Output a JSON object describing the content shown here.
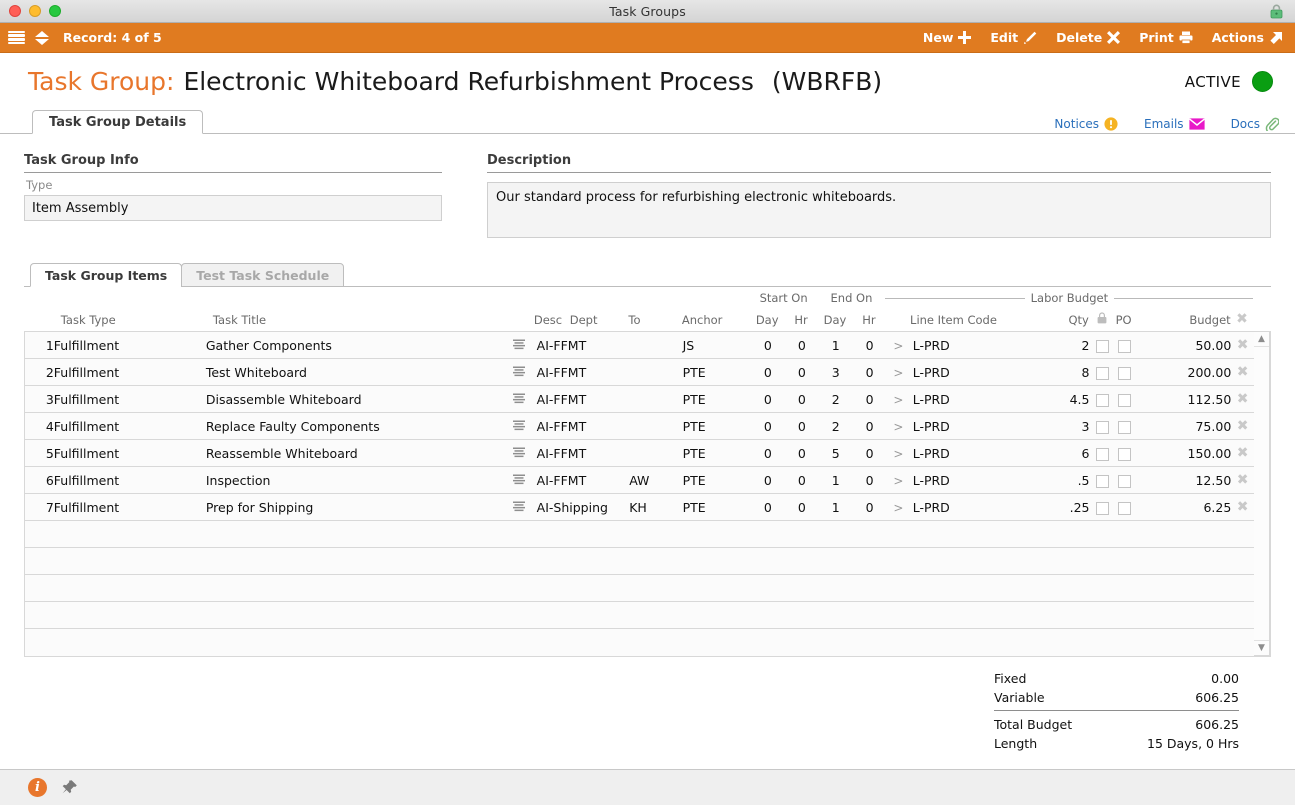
{
  "window": {
    "title": "Task Groups",
    "lock_icon": "lock-icon",
    "controls": [
      "close",
      "minimize",
      "zoom"
    ]
  },
  "toolbar": {
    "menu_icon": "hamburger-icon",
    "nav_icon": "up-down-arrows-icon",
    "record_label": "Record: 4 of 5",
    "accent_color": "#e07b20",
    "buttons": [
      {
        "label": "New",
        "icon": "plus-icon"
      },
      {
        "label": "Edit",
        "icon": "pencil-icon"
      },
      {
        "label": "Delete",
        "icon": "x-icon"
      },
      {
        "label": "Print",
        "icon": "printer-icon"
      },
      {
        "label": "Actions",
        "icon": "arrow-out-icon"
      }
    ]
  },
  "header": {
    "prefix": "Task Group:",
    "name": "Electronic Whiteboard Refurbishment Process",
    "code": "(WBRFB)",
    "status_text": "ACTIVE",
    "status_color": "#0a9e12",
    "prefix_color": "#e8762c"
  },
  "tabs_top": {
    "items": [
      {
        "label": "Task Group Details",
        "active": true
      }
    ],
    "links": [
      {
        "label": "Notices",
        "icon": "warning-icon"
      },
      {
        "label": "Emails",
        "icon": "envelope-icon"
      },
      {
        "label": "Docs",
        "icon": "paperclip-icon"
      }
    ]
  },
  "info_section": {
    "title": "Task Group Info",
    "type_label": "Type",
    "type_value": "Item Assembly"
  },
  "description_section": {
    "title": "Description",
    "value": "Our standard process for refurbishing electronic whiteboards."
  },
  "tabs_lower": [
    {
      "label": "Task Group Items",
      "active": true
    },
    {
      "label": "Test Task Schedule",
      "active": false
    }
  ],
  "grid": {
    "group_headers": [
      {
        "label": "Start On"
      },
      {
        "label": "End On"
      },
      {
        "label": "Labor Budget"
      }
    ],
    "columns": [
      "Task Type",
      "Task Title",
      "Desc",
      "Dept",
      "To",
      "Anchor",
      "Day",
      "Hr",
      "Day",
      "Hr",
      "Line Item Code",
      "Qty",
      "PO",
      "Budget"
    ],
    "lock_column_icon": "lock-icon",
    "delete_column_icon": "x-icon",
    "rows": [
      {
        "n": "1",
        "task_type": "Fulfillment",
        "task_title": "Gather Components",
        "desc": "desc-icon",
        "dept": "AI-FFMT",
        "to": "",
        "anchor": "JS",
        "start_day": "0",
        "start_hr": "0",
        "end_day": "1",
        "end_hr": "0",
        "line_item_code": "L-PRD",
        "qty": "2",
        "po": false,
        "budget": "50.00"
      },
      {
        "n": "2",
        "task_type": "Fulfillment",
        "task_title": "Test Whiteboard",
        "desc": "desc-icon",
        "dept": "AI-FFMT",
        "to": "",
        "anchor": "PTE",
        "start_day": "0",
        "start_hr": "0",
        "end_day": "3",
        "end_hr": "0",
        "line_item_code": "L-PRD",
        "qty": "8",
        "po": false,
        "budget": "200.00"
      },
      {
        "n": "3",
        "task_type": "Fulfillment",
        "task_title": "Disassemble Whiteboard",
        "desc": "desc-icon",
        "dept": "AI-FFMT",
        "to": "",
        "anchor": "PTE",
        "start_day": "0",
        "start_hr": "0",
        "end_day": "2",
        "end_hr": "0",
        "line_item_code": "L-PRD",
        "qty": "4.5",
        "po": false,
        "budget": "112.50"
      },
      {
        "n": "4",
        "task_type": "Fulfillment",
        "task_title": "Replace Faulty Components",
        "desc": "desc-icon",
        "dept": "AI-FFMT",
        "to": "",
        "anchor": "PTE",
        "start_day": "0",
        "start_hr": "0",
        "end_day": "2",
        "end_hr": "0",
        "line_item_code": "L-PRD",
        "qty": "3",
        "po": false,
        "budget": "75.00"
      },
      {
        "n": "5",
        "task_type": "Fulfillment",
        "task_title": "Reassemble Whiteboard",
        "desc": "desc-icon",
        "dept": "AI-FFMT",
        "to": "",
        "anchor": "PTE",
        "start_day": "0",
        "start_hr": "0",
        "end_day": "5",
        "end_hr": "0",
        "line_item_code": "L-PRD",
        "qty": "6",
        "po": false,
        "budget": "150.00"
      },
      {
        "n": "6",
        "task_type": "Fulfillment",
        "task_title": "Inspection",
        "desc": "desc-icon",
        "dept": "AI-FFMT",
        "to": "AW",
        "anchor": "PTE",
        "start_day": "0",
        "start_hr": "0",
        "end_day": "1",
        "end_hr": "0",
        "line_item_code": "L-PRD",
        "qty": ".5",
        "po": false,
        "budget": "12.50"
      },
      {
        "n": "7",
        "task_type": "Fulfillment",
        "task_title": "Prep for Shipping",
        "desc": "desc-icon",
        "dept": "AI-Shipping",
        "to": "KH",
        "anchor": "PTE",
        "start_day": "0",
        "start_hr": "0",
        "end_day": "1",
        "end_hr": "0",
        "line_item_code": "L-PRD",
        "qty": ".25",
        "po": false,
        "budget": "6.25"
      }
    ],
    "empty_row_count": 5
  },
  "totals": {
    "fixed_label": "Fixed",
    "fixed_value": "0.00",
    "variable_label": "Variable",
    "variable_value": "606.25",
    "total_label": "Total Budget",
    "total_value": "606.25",
    "length_label": "Length",
    "length_value": "15 Days, 0 Hrs"
  },
  "statusbar": {
    "info_icon": "info-icon",
    "pin_icon": "pin-icon"
  }
}
